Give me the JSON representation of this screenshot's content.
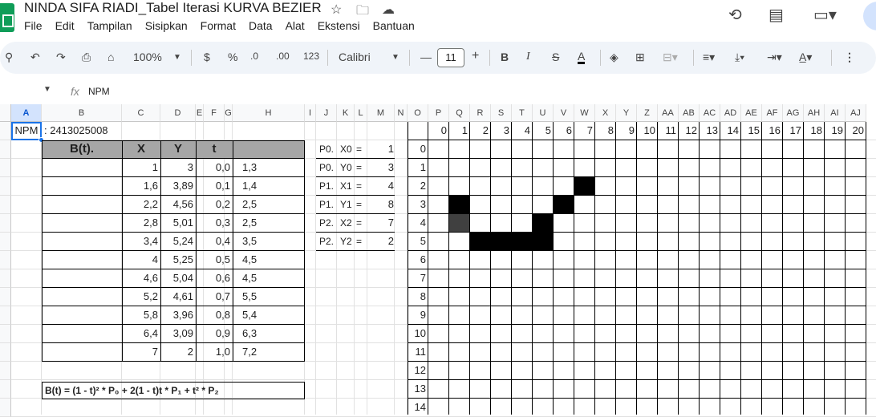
{
  "app": {
    "title": "NINDA SIFA RIADI_Tabel Iterasi KURVA BEZIER",
    "menu": [
      "File",
      "Edit",
      "Tampilan",
      "Sisipkan",
      "Format",
      "Data",
      "Alat",
      "Ekstensi",
      "Bantuan"
    ]
  },
  "toolbar": {
    "zoom": "100%",
    "currency": "$",
    "percent": "%",
    "dec_decrease": ".0",
    "dec_increase": ".00",
    "number_format": "123",
    "font": "Calibri",
    "font_size": "11",
    "bold": "B",
    "italic": "I",
    "strike": "S",
    "text_color": "A"
  },
  "formula_bar": {
    "value": "NPM"
  },
  "columns": [
    "A",
    "B",
    "C",
    "D",
    "E",
    "F",
    "G",
    "H",
    "I",
    "J",
    "K",
    "L",
    "M",
    "N",
    "O",
    "P",
    "Q",
    "R",
    "S",
    "T",
    "U",
    "V",
    "W",
    "X",
    "Y",
    "Z",
    "AA",
    "AB",
    "AC",
    "AD",
    "AE",
    "AF",
    "AG",
    "AH",
    "AI",
    "AJ"
  ],
  "selected_column": "A",
  "npm": {
    "label": "NPM",
    "value": ": 2413025008"
  },
  "bezier_table": {
    "headers": [
      "B(t).",
      "X",
      "Y",
      "t",
      ""
    ],
    "rows": [
      [
        "1",
        "3",
        "0,0",
        "1,3"
      ],
      [
        "1,6",
        "3,89",
        "0,1",
        "1,4"
      ],
      [
        "2,2",
        "4,56",
        "0,2",
        "2,5"
      ],
      [
        "2,8",
        "5,01",
        "0,3",
        "2,5"
      ],
      [
        "3,4",
        "5,24",
        "0,4",
        "3,5"
      ],
      [
        "4",
        "5,25",
        "0,5",
        "4,5"
      ],
      [
        "4,6",
        "5,04",
        "0,6",
        "4,5"
      ],
      [
        "5,2",
        "4,61",
        "0,7",
        "5,5"
      ],
      [
        "5,8",
        "3,96",
        "0,8",
        "5,4"
      ],
      [
        "6,4",
        "3,09",
        "0,9",
        "6,3"
      ],
      [
        "7",
        "2",
        "1,0",
        "7,2"
      ]
    ],
    "formula": "B(t) = (1 - t)² * P₀ + 2(1 - t)t * P₁ + t² * P₂"
  },
  "control_points": [
    {
      "p": "P0.",
      "v": "X0",
      "eq": "=",
      "val": "1"
    },
    {
      "p": "P0.",
      "v": "Y0",
      "eq": "=",
      "val": "3"
    },
    {
      "p": "P1.",
      "v": "X1",
      "eq": "=",
      "val": "4"
    },
    {
      "p": "P1.",
      "v": "Y1",
      "eq": "=",
      "val": "8"
    },
    {
      "p": "P2.",
      "v": "X2",
      "eq": "=",
      "val": "7"
    },
    {
      "p": "P2.",
      "v": "Y2",
      "eq": "=",
      "val": "2"
    }
  ],
  "pixel_grid": {
    "x_labels": [
      "0",
      "1",
      "2",
      "3",
      "4",
      "5",
      "6",
      "7",
      "8",
      "9",
      "10",
      "11",
      "12",
      "13",
      "14",
      "15",
      "16",
      "17",
      "18",
      "19",
      "20"
    ],
    "y_labels": [
      "0",
      "1",
      "2",
      "3",
      "4",
      "5",
      "6",
      "7",
      "8",
      "9",
      "10",
      "11",
      "12",
      "13",
      "14"
    ],
    "filled_cells": [
      {
        "x": 7,
        "y": 2,
        "shade": "#000000"
      },
      {
        "x": 1,
        "y": 3,
        "shade": "#000000"
      },
      {
        "x": 6,
        "y": 3,
        "shade": "#000000"
      },
      {
        "x": 1,
        "y": 4,
        "shade": "#404040"
      },
      {
        "x": 5,
        "y": 4,
        "shade": "#000000"
      },
      {
        "x": 2,
        "y": 5,
        "shade": "#000000"
      },
      {
        "x": 3,
        "y": 5,
        "shade": "#000000"
      },
      {
        "x": 4,
        "y": 5,
        "shade": "#000000"
      },
      {
        "x": 5,
        "y": 5,
        "shade": "#000000"
      }
    ]
  }
}
